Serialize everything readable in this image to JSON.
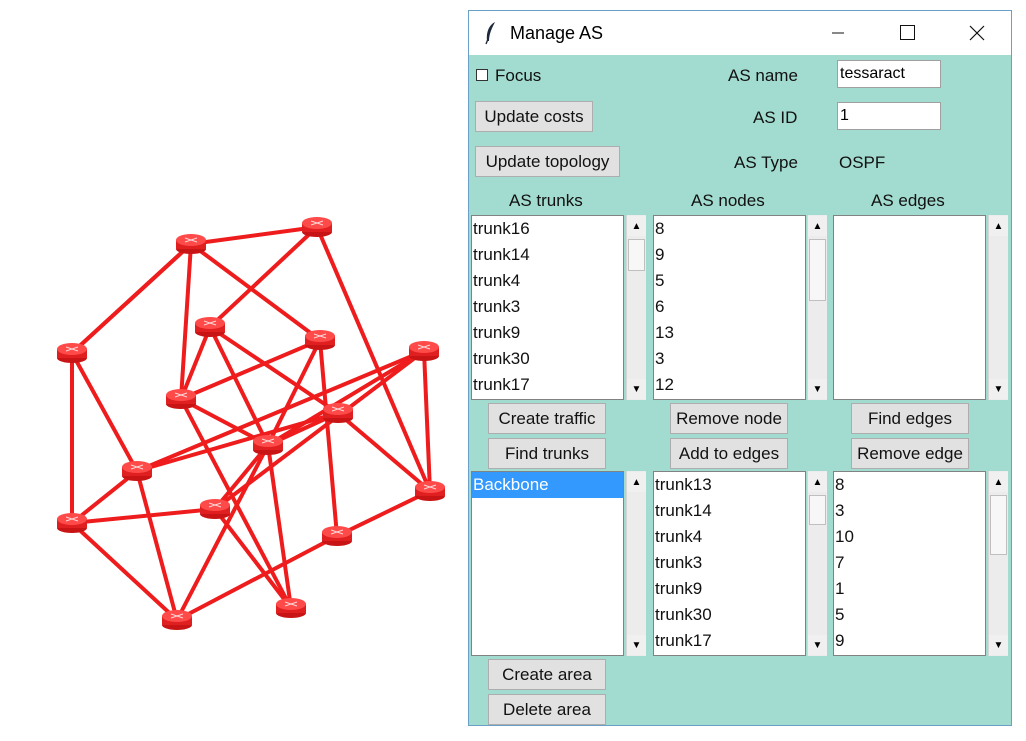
{
  "window": {
    "title": "Manage AS",
    "minimize_glyph": "—",
    "close_glyph": "✕"
  },
  "form": {
    "focus_label": "Focus",
    "update_costs_label": "Update costs",
    "update_topology_label": "Update topology",
    "as_name_label": "AS name",
    "as_name_value": "tessaract",
    "as_id_label": "AS ID",
    "as_id_value": "1",
    "as_type_label": "AS Type",
    "as_type_value": "OSPF"
  },
  "headers": {
    "trunks": "AS trunks",
    "nodes": "AS nodes",
    "edges": "AS edges"
  },
  "lists": {
    "as_trunks": [
      "trunk16",
      "trunk14",
      "trunk4",
      "trunk3",
      "trunk9",
      "trunk30",
      "trunk17"
    ],
    "as_nodes": [
      "8",
      "9",
      "5",
      "6",
      "13",
      "3",
      "12"
    ],
    "as_edges": [],
    "areas": [
      "Backbone"
    ],
    "area_trunks": [
      "trunk13",
      "trunk14",
      "trunk4",
      "trunk3",
      "trunk9",
      "trunk30",
      "trunk17"
    ],
    "area_nodes": [
      "8",
      "3",
      "10",
      "7",
      "1",
      "5",
      "9"
    ]
  },
  "buttons": {
    "create_traffic": "Create traffic",
    "find_trunks": "Find trunks",
    "remove_node": "Remove node",
    "add_to_edges": "Add to edges",
    "find_edges": "Find edges",
    "remove_edge": "Remove edge",
    "create_area": "Create area",
    "delete_area": "Delete area"
  },
  "graph": {
    "color": "#ee1c1c"
  },
  "colors": {
    "window_bg": "#a2dbcf",
    "selection": "#3399ff"
  }
}
